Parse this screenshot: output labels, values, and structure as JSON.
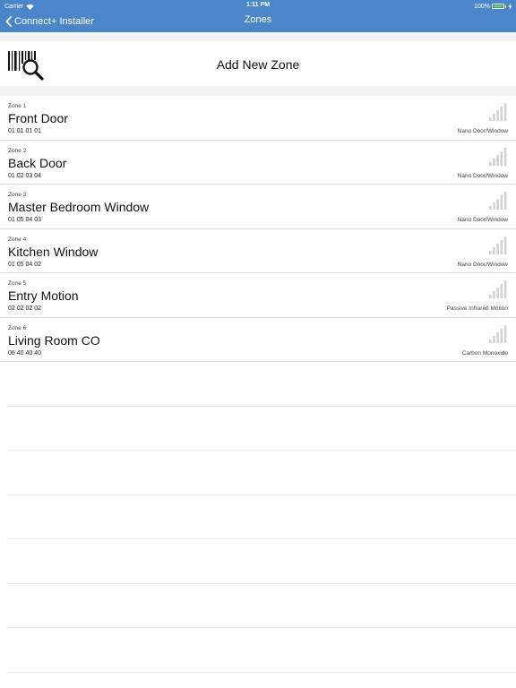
{
  "status_bar": {
    "carrier": "Carrier",
    "time": "1:11 PM",
    "battery": "100%",
    "battery_level": 1.0
  },
  "nav": {
    "back_label": "Connect+ Installer",
    "title": "Zones"
  },
  "add_zone": {
    "label": "Add New Zone",
    "icon": "barcode-search-icon"
  },
  "zones": [
    {
      "number": "Zone 1",
      "name": "Front Door",
      "id": "01 01 01 01",
      "type": "Nano Door/Window"
    },
    {
      "number": "Zone 2",
      "name": "Back Door",
      "id": "01 02 03 04",
      "type": "Nano Door/Window"
    },
    {
      "number": "Zone 3",
      "name": "Master Bedroom Window",
      "id": "01 05 04 03",
      "type": "Nano Door/Window"
    },
    {
      "number": "Zone 4",
      "name": "Kitchen Window",
      "id": "01 05 04 02",
      "type": "Nano Door/Window"
    },
    {
      "number": "Zone 5",
      "name": "Entry Motion",
      "id": "02 02 02 02",
      "type": "Passive Infrared Motion"
    },
    {
      "number": "Zone 6",
      "name": "Living Room CO",
      "id": "06 40 40 40",
      "type": "Carbon Monoxide"
    }
  ],
  "colors": {
    "nav_bar": "#4a86c8",
    "battery": "#5fdb5a",
    "signal_bars": "#d2d2d2"
  }
}
